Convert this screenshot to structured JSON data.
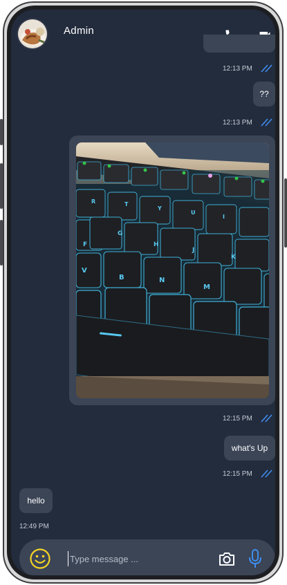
{
  "header": {
    "title": "Admin",
    "call_icon": "phone-icon",
    "video_icon": "video-camera-icon"
  },
  "messages": [
    {
      "type": "text",
      "direction": "outgoing",
      "text": "",
      "time": "12:13 PM",
      "status": "read"
    },
    {
      "type": "text",
      "direction": "outgoing",
      "text": "??",
      "time": "12:13 PM",
      "status": "read"
    },
    {
      "type": "image",
      "direction": "outgoing",
      "image_subject": "keyboard photo",
      "time": "12:15 PM",
      "status": "read"
    },
    {
      "type": "text",
      "direction": "outgoing",
      "text": "what's Up",
      "time": "12:15 PM",
      "status": "read"
    },
    {
      "type": "text",
      "direction": "incoming",
      "text": "hello",
      "time": "12:49 PM"
    }
  ],
  "composer": {
    "placeholder": "Type message ...",
    "emoji_icon": "emoji-icon",
    "camera_icon": "camera-icon",
    "mic_icon": "microphone-icon"
  },
  "colors": {
    "background": "#232c3d",
    "bubble": "#3b4556",
    "read_tick": "#3f8ef0",
    "emoji": "#f5d326",
    "mic": "#3f8ef0"
  }
}
